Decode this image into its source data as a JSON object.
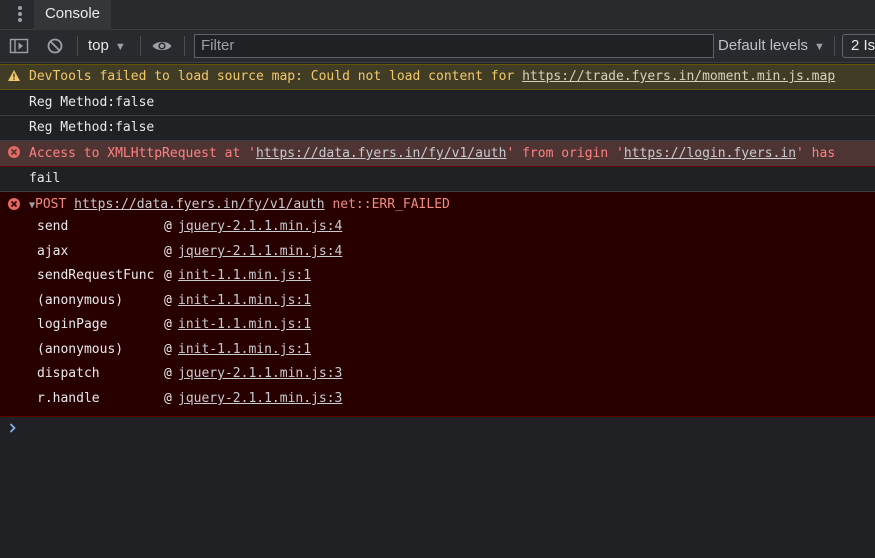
{
  "tabs": {
    "console": "Console"
  },
  "toolbar": {
    "context": "top",
    "filter_placeholder": "Filter",
    "levels": "Default levels",
    "issues": "2 Is"
  },
  "messages": {
    "warning": {
      "text": "DevTools failed to load source map: Could not load content for ",
      "link": "https://trade.fyers.in/moment.min.js.map"
    },
    "log1": "Reg Method:false",
    "log2": "Reg Method:false",
    "cors_error": {
      "prefix": "Access to XMLHttpRequest at '",
      "url": "https://data.fyers.in/fy/v1/auth",
      "middle": "' from origin '",
      "origin": "https://login.fyers.in",
      "suffix": "' has"
    },
    "log3": "fail",
    "post_error": {
      "method": "POST",
      "url": "https://data.fyers.in/fy/v1/auth",
      "status": "net::ERR_FAILED",
      "stack": [
        {
          "fn": "send",
          "loc": "jquery-2.1.1.min.js:4"
        },
        {
          "fn": "ajax",
          "loc": "jquery-2.1.1.min.js:4"
        },
        {
          "fn": "sendRequestFunc",
          "loc": "init-1.1.min.js:1"
        },
        {
          "fn": "(anonymous)",
          "loc": "init-1.1.min.js:1"
        },
        {
          "fn": "loginPage",
          "loc": "init-1.1.min.js:1"
        },
        {
          "fn": "(anonymous)",
          "loc": "init-1.1.min.js:1"
        },
        {
          "fn": "dispatch",
          "loc": "jquery-2.1.1.min.js:3"
        },
        {
          "fn": "r.handle",
          "loc": "jquery-2.1.1.min.js:3"
        }
      ]
    }
  },
  "colors": {
    "background": "#202124",
    "warning_bg": "#413c26",
    "error_bg": "#4e3534",
    "error_block_bg": "#290000",
    "prompt": "#8ab4f8"
  }
}
